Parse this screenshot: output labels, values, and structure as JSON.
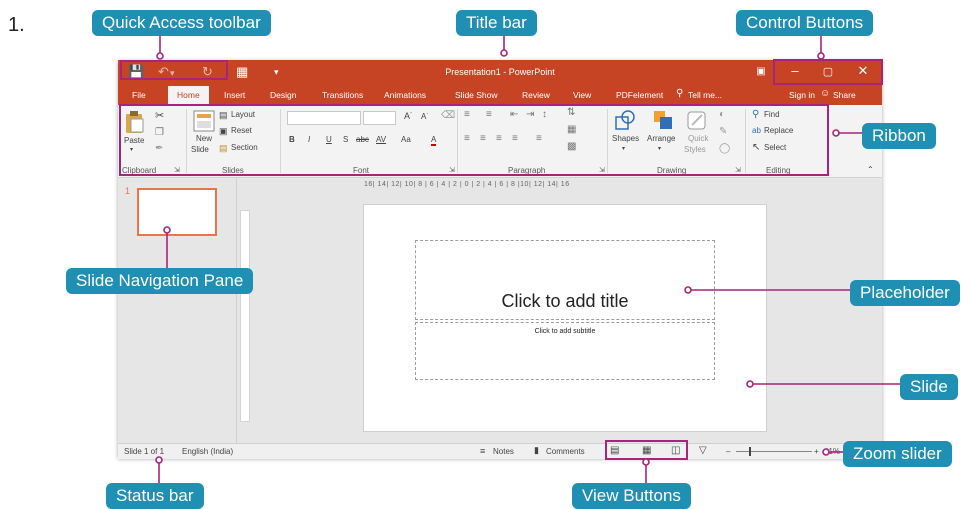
{
  "figure": {
    "number": "1.",
    "callouts": {
      "quick_access": "Quick Access toolbar",
      "title_bar": "Title bar",
      "control_buttons": "Control Buttons",
      "ribbon": "Ribbon",
      "slide_nav_pane": "Slide Navigation Pane",
      "placeholder": "Placeholder",
      "slide": "Slide",
      "zoom_slider": "Zoom slider",
      "status_bar": "Status bar",
      "view_buttons": "View Buttons"
    },
    "colors": {
      "callout": "#1f8fb3",
      "highlight": "#a8237a",
      "accent": "#c64323"
    }
  },
  "window": {
    "title": "Presentation1 - PowerPoint",
    "tabs": [
      "File",
      "Home",
      "Insert",
      "Design",
      "Transitions",
      "Animations",
      "Slide Show",
      "Review",
      "View",
      "PDFelement"
    ],
    "tell_me": "Tell me...",
    "sign_in": "Sign in",
    "share": "Share",
    "ribbon": {
      "clipboard": {
        "label": "Clipboard",
        "paste": "Paste"
      },
      "slides": {
        "label": "Slides",
        "new_slide_1": "New",
        "new_slide_2": "Slide",
        "layout": "Layout",
        "reset": "Reset",
        "section": "Section"
      },
      "font": {
        "label": "Font",
        "bold": "B",
        "italic": "I",
        "underline": "U",
        "shadow": "S",
        "strike": "abc",
        "spacing": "AV",
        "case": "Aa",
        "color": "A"
      },
      "paragraph": {
        "label": "Paragraph"
      },
      "drawing": {
        "label": "Drawing",
        "shapes": "Shapes",
        "arrange": "Arrange",
        "quick_1": "Quick",
        "quick_2": "Styles"
      },
      "editing": {
        "label": "Editing",
        "find": "Find",
        "replace": "Replace",
        "select": "Select"
      }
    },
    "nav": {
      "thumb_number": "1"
    },
    "ruler": "16| 14| 12| 10| 8 | 6 | 4 | 2 | 0 | 2 | 4 | 6 | 8 |10| 12| 14| 16",
    "slide": {
      "title_placeholder": "Click to add title",
      "subtitle_placeholder": "Click to add subtitle"
    },
    "status": {
      "slide": "Slide 1 of 1",
      "language": "English (India)",
      "notes": "Notes",
      "comments": "Comments",
      "zoom": "41%"
    }
  }
}
